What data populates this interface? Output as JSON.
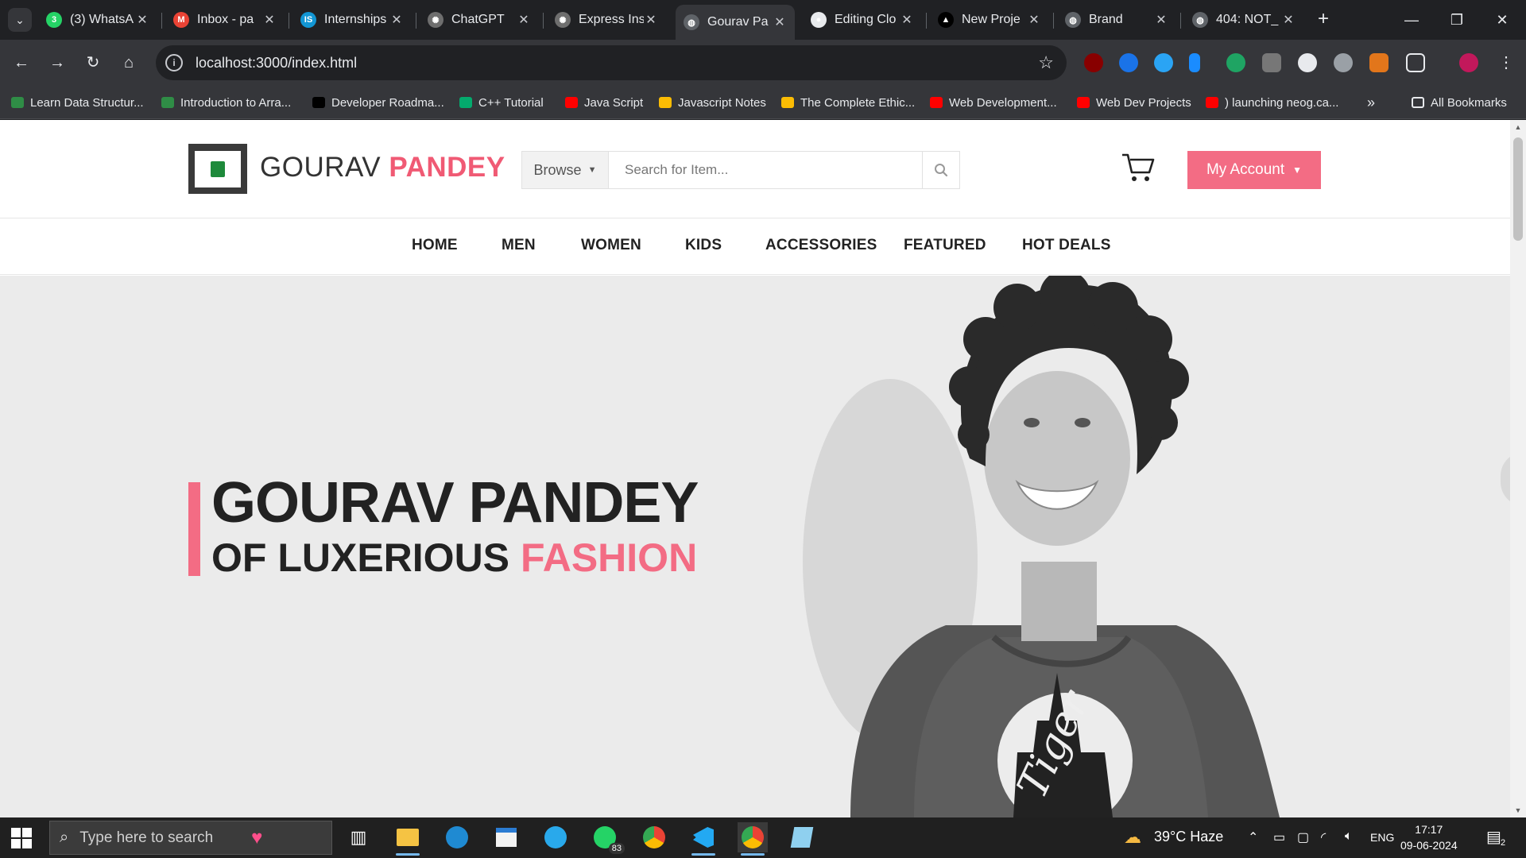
{
  "browser": {
    "tabs": [
      {
        "title": "(3) WhatsA",
        "favicon": "whatsapp-icon",
        "color": "#25d366",
        "glyph": "3"
      },
      {
        "title": "Inbox - pa",
        "favicon": "gmail-icon",
        "color": "#ea4335",
        "glyph": "M"
      },
      {
        "title": "Internships",
        "favicon": "internshala-icon",
        "color": "#1296d4",
        "glyph": "IS"
      },
      {
        "title": "ChatGPT",
        "favicon": "chatgpt-icon",
        "color": "#6e6e6e",
        "glyph": "✺"
      },
      {
        "title": "Express Ins",
        "favicon": "chatgpt-icon",
        "color": "#6e6e6e",
        "glyph": "✺"
      },
      {
        "title": "Gourav Pa",
        "favicon": "globe-icon",
        "color": "#5f6368",
        "glyph": "◍",
        "active": true
      },
      {
        "title": "Editing Clo",
        "favicon": "github-icon",
        "color": "#e8eaed",
        "glyph": "●"
      },
      {
        "title": "New Proje",
        "favicon": "vercel-icon",
        "color": "#000000",
        "glyph": "▲"
      },
      {
        "title": "Brand",
        "favicon": "globe-icon",
        "color": "#5f6368",
        "glyph": "◍"
      },
      {
        "title": "404: NOT_",
        "favicon": "globe-icon",
        "color": "#5f6368",
        "glyph": "◍"
      }
    ],
    "url": "localhost:3000/index.html",
    "bookmarks": [
      {
        "label": "Learn Data Structur...",
        "icon": "gfg-icon",
        "color": "#2f8d46"
      },
      {
        "label": "Introduction to Arra...",
        "icon": "gfg-icon",
        "color": "#2f8d46"
      },
      {
        "label": "Developer Roadma...",
        "icon": "roadmap-icon",
        "color": "#000000"
      },
      {
        "label": "C++ Tutorial",
        "icon": "w3schools-icon",
        "color": "#04aa6d"
      },
      {
        "label": "Java Script",
        "icon": "youtube-icon",
        "color": "#ff0000"
      },
      {
        "label": "Javascript Notes",
        "icon": "drive-icon",
        "color": "#fbbc04"
      },
      {
        "label": "The Complete Ethic...",
        "icon": "drive-icon",
        "color": "#fbbc04"
      },
      {
        "label": "Web Development...",
        "icon": "youtube-icon",
        "color": "#ff0000"
      },
      {
        "label": "Web Dev Projects",
        "icon": "youtube-icon",
        "color": "#ff0000"
      },
      {
        "label": ") launching neog.ca...",
        "icon": "youtube-icon",
        "color": "#ff0000"
      }
    ],
    "all_bookmarks": "All Bookmarks"
  },
  "site": {
    "brand_first": "GOURAV",
    "brand_second": "PANDEY",
    "browse_label": "Browse",
    "search_placeholder": "Search for Item...",
    "account_label": "My Account",
    "accent": "#f36c84",
    "nav": [
      "HOME",
      "MEN",
      "WOMEN",
      "KIDS",
      "ACCESSORIES",
      "FEATURED",
      "HOT DEALS"
    ],
    "hero_title": "GOURAV PANDEY",
    "hero_sub_plain": "OF LUXERIOUS",
    "hero_sub_accent": "FASHION",
    "hero_shirt_text": "Tiger"
  },
  "taskbar": {
    "search_placeholder": "Type here to search",
    "whatsapp_badge": "83",
    "weather": "39°C  Haze",
    "language": "ENG",
    "time": "17:17",
    "date": "09-06-2024",
    "notifications": "2"
  }
}
